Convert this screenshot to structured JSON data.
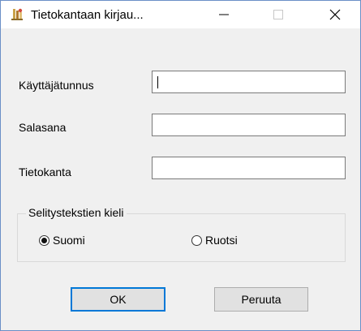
{
  "window": {
    "title": "Tietokantaan kirjau...",
    "icon": "database-app-icon",
    "controls": {
      "minimize": "minimize-icon",
      "maximize": "maximize-icon",
      "close": "close-icon"
    }
  },
  "form": {
    "username_label": "Käyttäjätunnus",
    "username_value": "",
    "password_label": "Salasana",
    "password_value": "",
    "database_label": "Tietokanta",
    "database_value": ""
  },
  "language": {
    "group_label": "Selitystekstien kieli",
    "options": [
      {
        "label": "Suomi",
        "selected": true
      },
      {
        "label": "Ruotsi",
        "selected": false
      }
    ]
  },
  "buttons": {
    "ok_label": "OK",
    "cancel_label": "Peruuta"
  },
  "colors": {
    "focus_border": "#0078d7",
    "window_border": "#6b8fc7",
    "dialog_bg": "#f0f0f0"
  }
}
